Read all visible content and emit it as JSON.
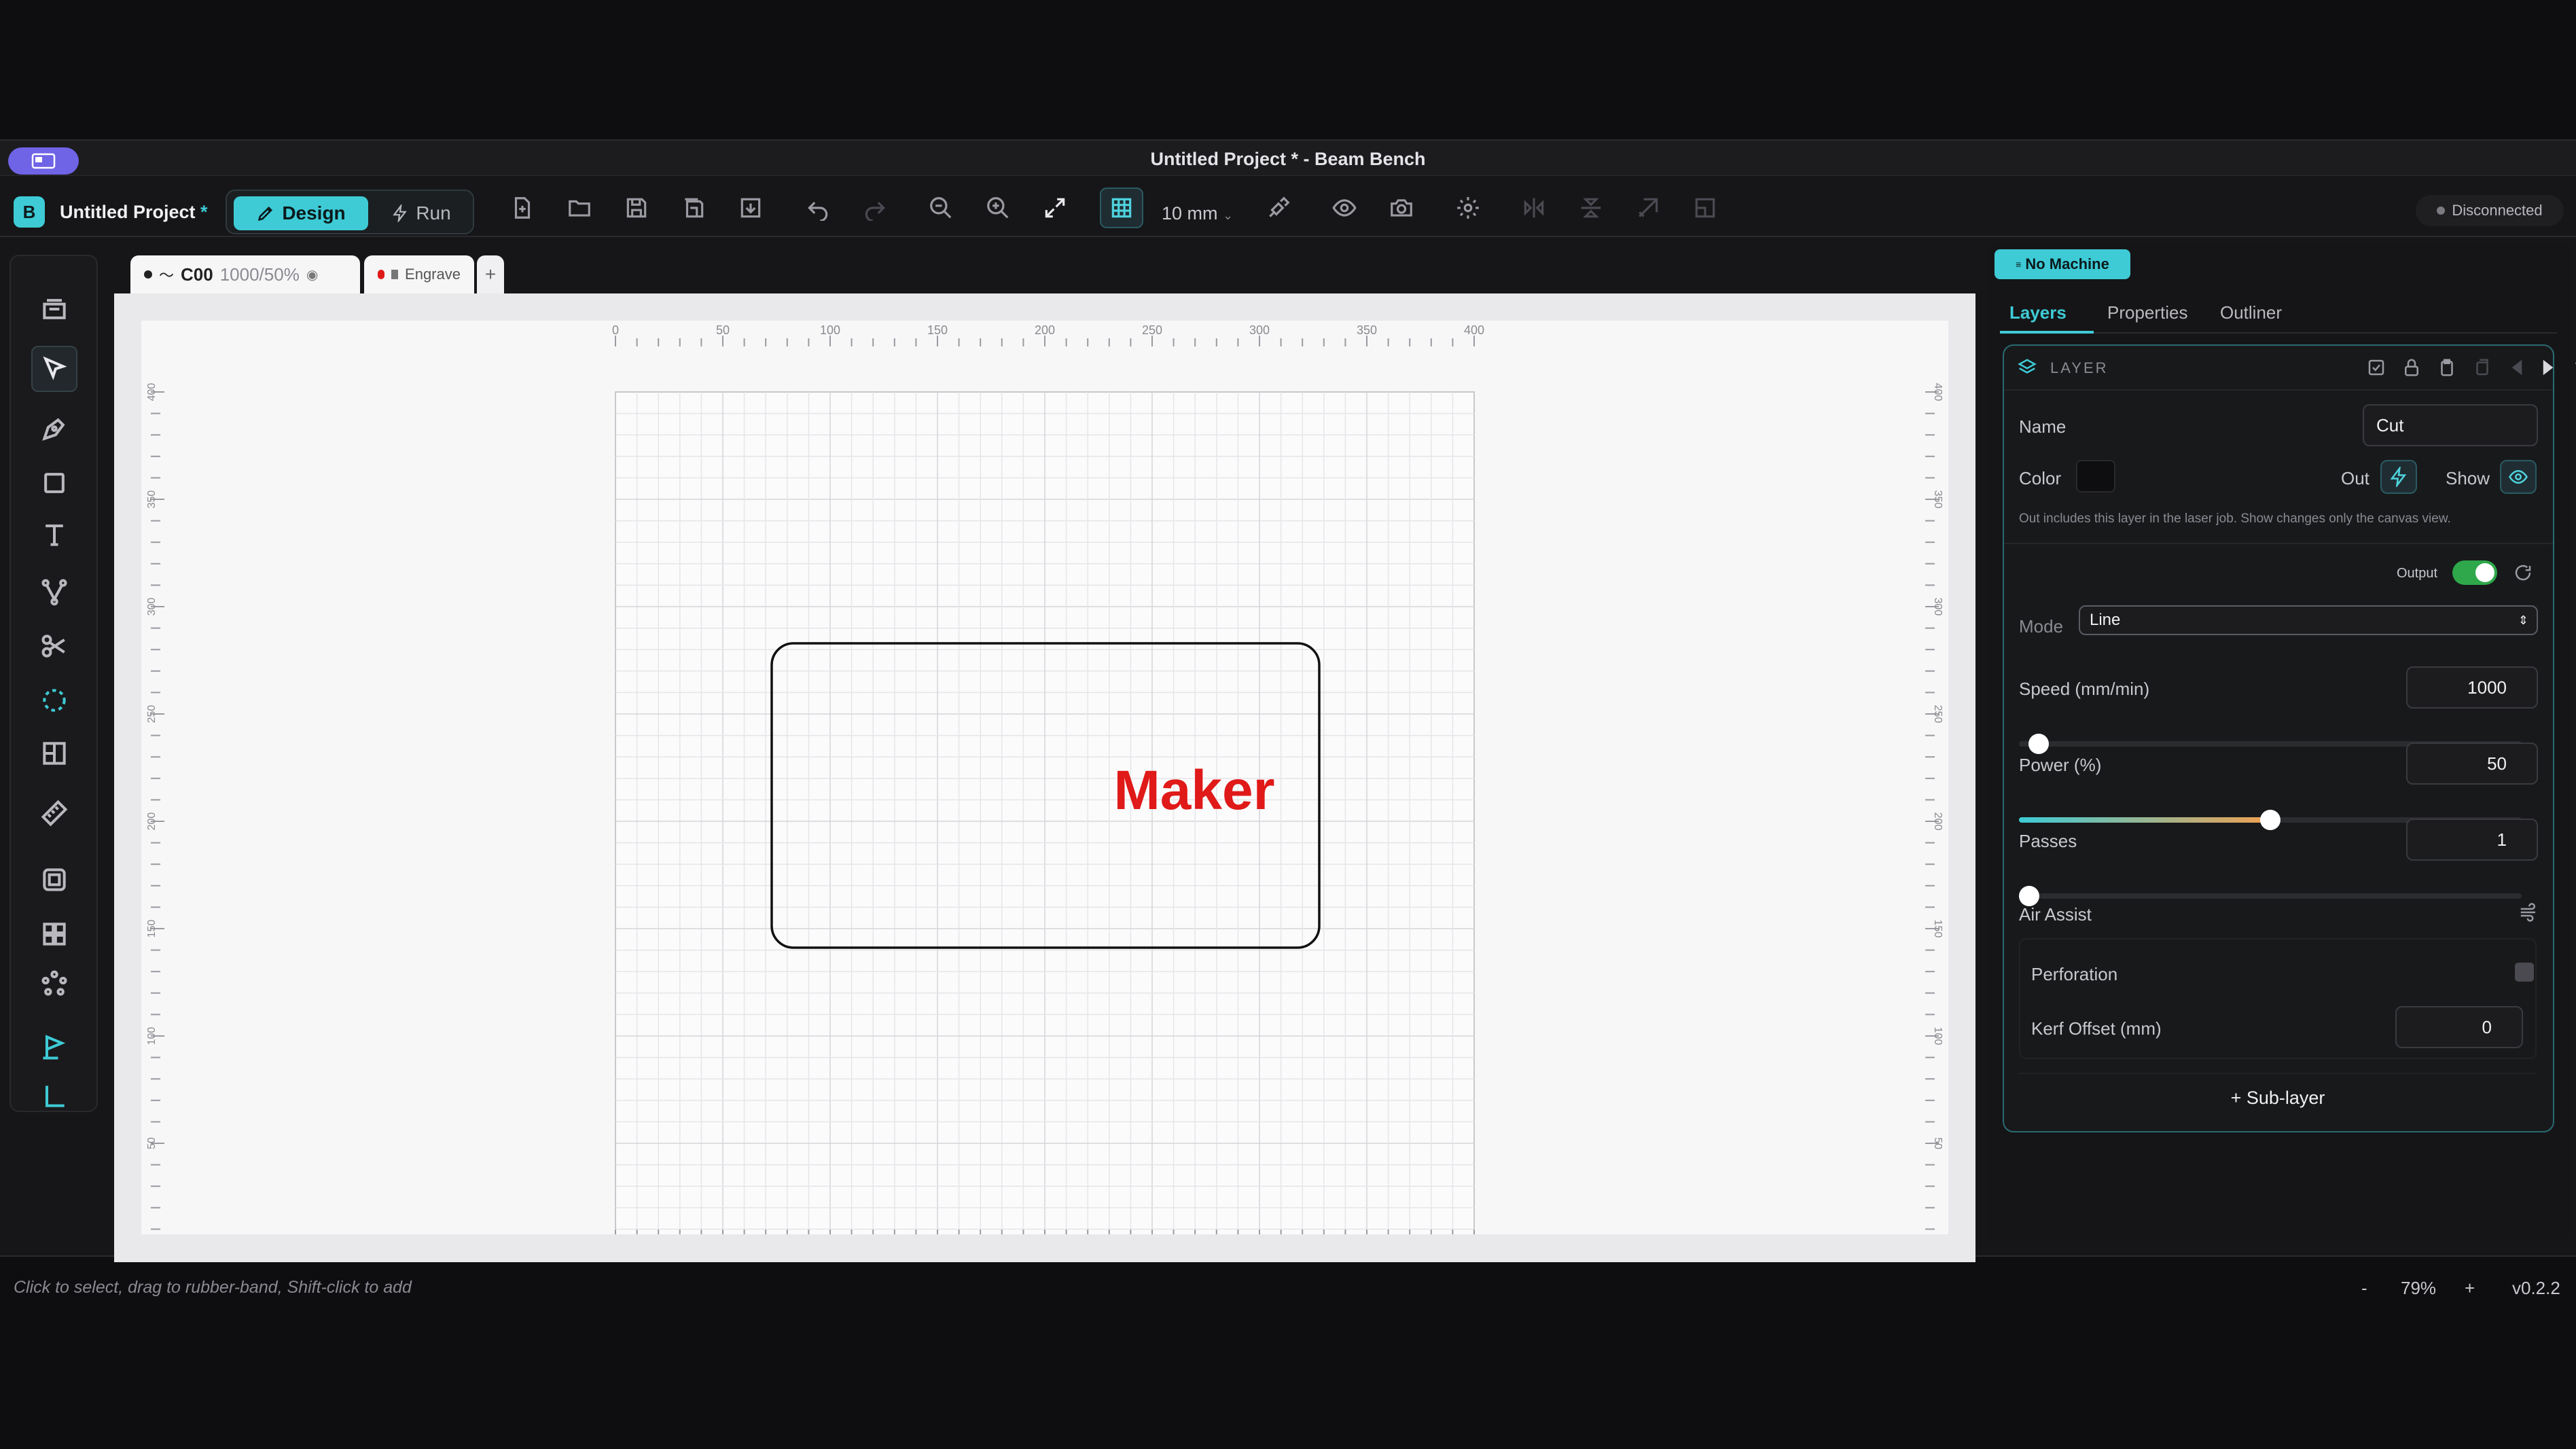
{
  "window": {
    "title": "Untitled Project * - Beam Bench"
  },
  "toolbar": {
    "project_name": "Untitled Project",
    "unsaved_mark": "*",
    "logo_letter": "B",
    "design_label": "Design",
    "run_label": "Run",
    "grid_size": "10 mm",
    "connection_status": "Disconnected"
  },
  "tabs": [
    {
      "label": "C00",
      "params": "1000/50%"
    },
    {
      "label": "Engrave"
    }
  ],
  "add_tab_label": "+",
  "canvas": {
    "text": "Maker",
    "text_color": "#e01919",
    "ruler_ticks": [
      "0",
      "50",
      "100",
      "150",
      "200",
      "250",
      "300",
      "350",
      "400"
    ]
  },
  "panel": {
    "machine_badge": "No Machine",
    "tabs": [
      "Layers",
      "Properties",
      "Outliner"
    ],
    "layer_header": "LAYER",
    "name_label": "Name",
    "name_value": "Cut",
    "color_label": "Color",
    "out_label": "Out",
    "show_label": "Show",
    "hint": "Out includes this layer in the laser job. Show changes only the canvas view.",
    "output_label": "Output",
    "mode_label": "Mode",
    "mode_value": "Line",
    "speed_label": "Speed (mm/min)",
    "speed_value": "1000",
    "speed_fraction": 0.02,
    "power_label": "Power (%)",
    "power_value": "50",
    "power_fraction": 0.5,
    "passes_label": "Passes",
    "passes_value": "1",
    "passes_fraction": 0.0,
    "air_assist_label": "Air Assist",
    "perforation_label": "Perforation",
    "kerf_label": "Kerf Offset (mm)",
    "kerf_value": "0",
    "sublayer_label": "+ Sub-layer"
  },
  "status": {
    "hint": "Click to select, drag to rubber-band, Shift-click to add",
    "zoom_minus": "-",
    "zoom": "79%",
    "zoom_plus": "+",
    "version": "v0.2.2"
  },
  "colors": {
    "accent": "#3ecbd6",
    "cut_red": "#e01919"
  }
}
